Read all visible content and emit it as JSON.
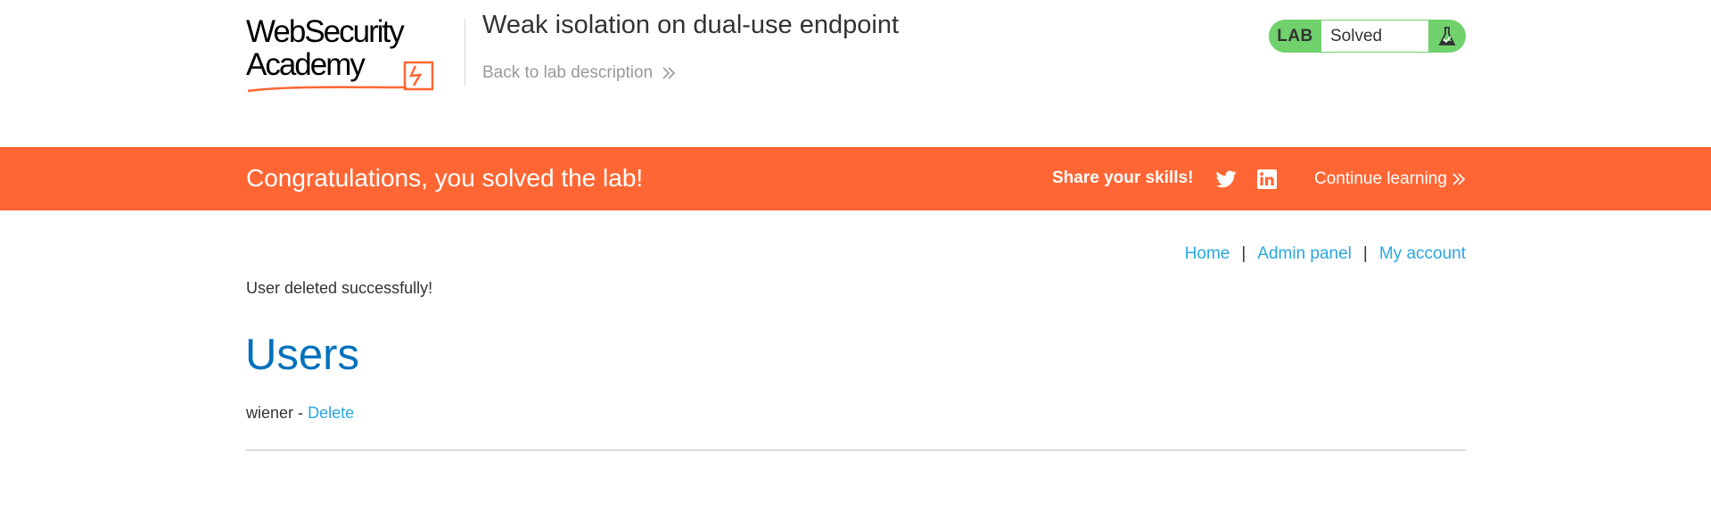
{
  "header": {
    "logo_line1": "WebSecurity",
    "logo_line2": "Academy",
    "title": "Weak isolation on dual-use endpoint",
    "back_link": "Back to lab description",
    "status": {
      "badge": "LAB",
      "text": "Solved",
      "icon": "flask-icon",
      "color": "#70d16d"
    }
  },
  "banner": {
    "message": "Congratulations, you solved the lab!",
    "share_label": "Share your skills!",
    "share_icons": [
      "twitter-icon",
      "linkedin-icon"
    ],
    "continue_label": "Continue learning",
    "color": "#ff6633"
  },
  "nav": {
    "home": "Home",
    "admin_panel": "Admin panel",
    "my_account": "My account",
    "separator": "|"
  },
  "main": {
    "message": "User deleted successfully!",
    "heading": "Users",
    "users": [
      {
        "name": "wiener",
        "separator": "-",
        "action": "Delete"
      }
    ]
  },
  "colors": {
    "link": "#29a7e1",
    "heading": "#0071bc",
    "text": "#333332"
  }
}
